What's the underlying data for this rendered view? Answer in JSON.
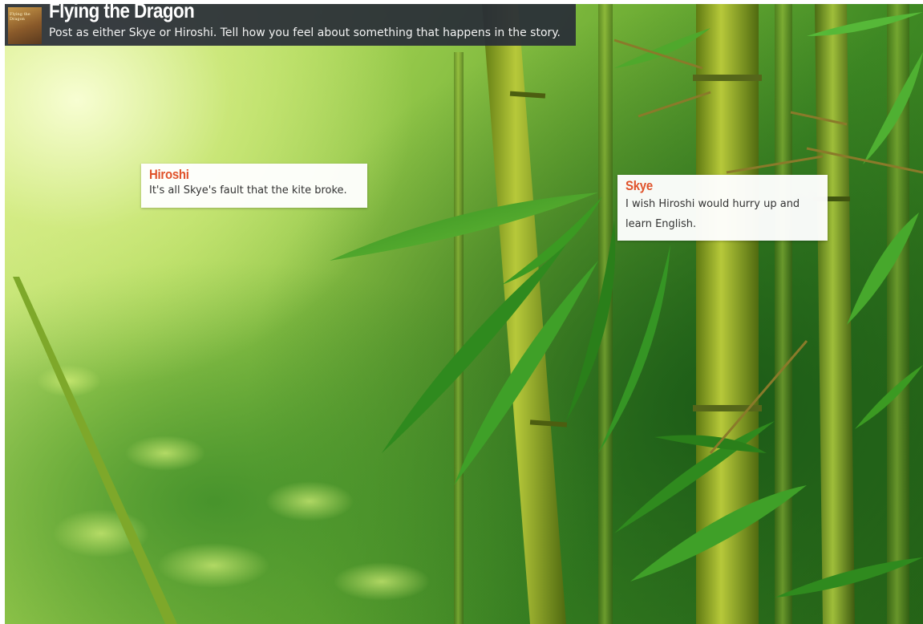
{
  "banner": {
    "title": "Flying the Dragon",
    "subtitle": "Post as either Skye or Hiroshi. Tell how you feel about something that happens in the story.",
    "thumbnail_caption": "Flying the Dragon"
  },
  "posts": [
    {
      "author": "Hiroshi",
      "text": "It's all Skye's fault that the kite broke."
    },
    {
      "author": "Skye",
      "text": "I wish Hiroshi would hurry up and learn English."
    }
  ],
  "colors": {
    "banner_bg": "#282d37",
    "author_accent": "#e0522a",
    "post_text": "#333333",
    "post_bg": "#ffffff"
  },
  "background": {
    "image": "bamboo-forest"
  }
}
